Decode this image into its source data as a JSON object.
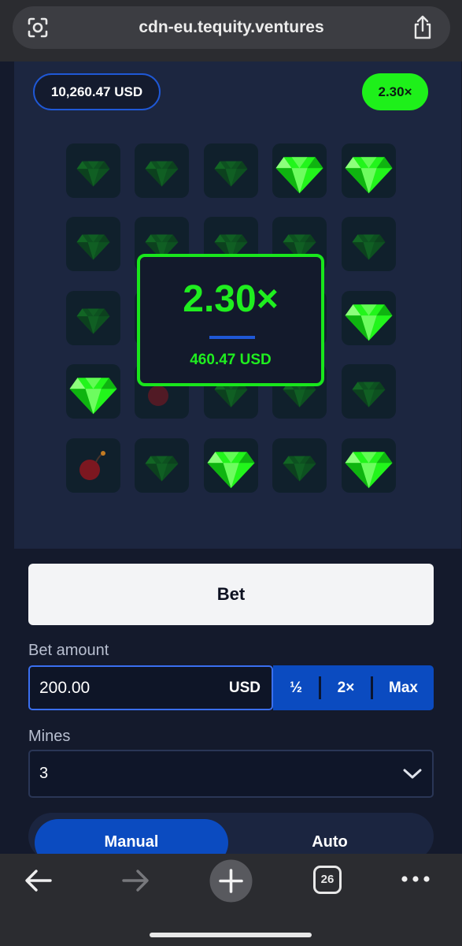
{
  "browser": {
    "url": "cdn-eu.tequity.ventures",
    "tab_count": "26"
  },
  "game": {
    "balance": "10,260.47 USD",
    "multiplier_badge": "2.30×",
    "result": {
      "multiplier": "2.30×",
      "amount": "460.47 USD"
    },
    "grid": [
      [
        "gem-dim",
        "gem-dim",
        "gem-dim",
        "gem-bright",
        "gem-bright"
      ],
      [
        "gem-dim",
        "gem-dim",
        "gem-dim",
        "gem-dim",
        "gem-dim"
      ],
      [
        "gem-dim",
        "gem-dim",
        "gem-dim",
        "gem-dim",
        "gem-bright"
      ],
      [
        "gem-bright",
        "mine-dim",
        "gem-dim",
        "gem-dim",
        "gem-dim"
      ],
      [
        "bomb",
        "gem-dim",
        "gem-bright",
        "gem-dim",
        "gem-bright"
      ]
    ]
  },
  "controls": {
    "bet_label": "Bet",
    "bet_amount_label": "Bet amount",
    "bet_amount_value": "200.00",
    "bet_currency": "USD",
    "half": "½",
    "double": "2×",
    "max": "Max",
    "mines_label": "Mines",
    "mines_value": "3",
    "mode_manual": "Manual",
    "mode_auto": "Auto"
  },
  "colors": {
    "accent_green": "#1fee1f",
    "accent_blue": "#0b4bc0",
    "panel": "#1c2640"
  }
}
